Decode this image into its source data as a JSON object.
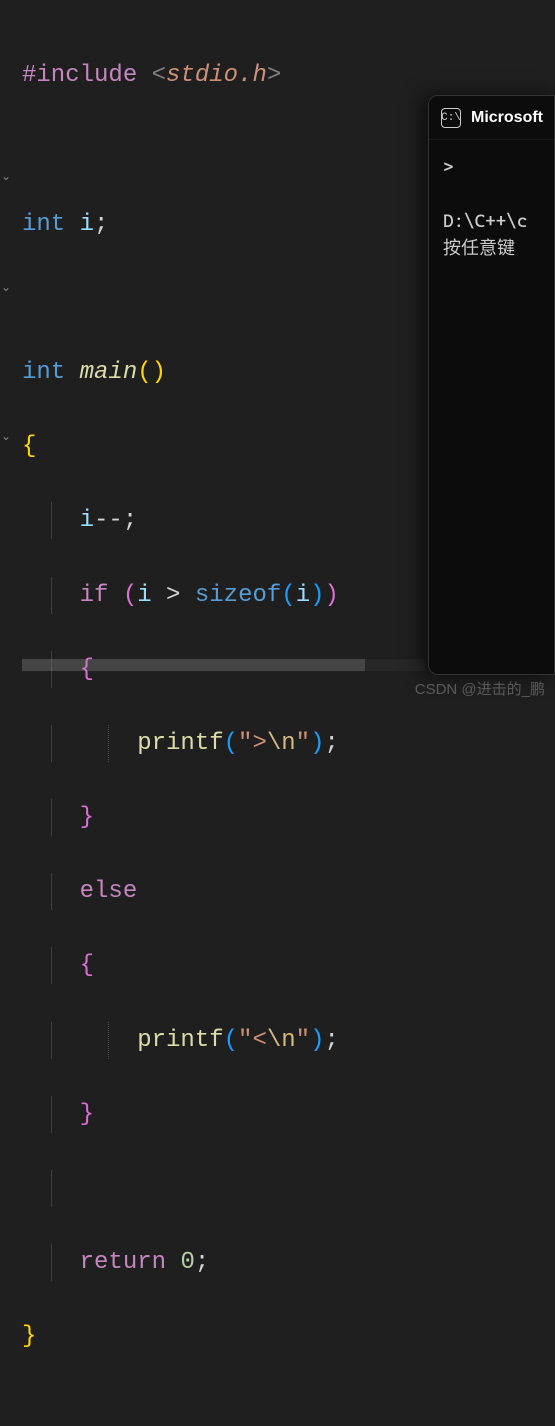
{
  "code": {
    "preproc_directive": "#include",
    "header_open": "<",
    "header_name": "stdio.h",
    "header_close": ">",
    "int_kw": "int",
    "var_i": "i",
    "semicolon": ";",
    "main_name": "main",
    "open_paren": "(",
    "close_paren": ")",
    "open_brace": "{",
    "close_brace": "}",
    "decrement": "--",
    "if_kw": "if",
    "gt_op": ">",
    "sizeof_kw": "sizeof",
    "printf_name": "printf",
    "string_gt_open": "\"",
    "string_gt_body": ">",
    "string_lt_body": "<",
    "escape_n": "\\n",
    "string_close": "\"",
    "else_kw": "else",
    "return_kw": "return",
    "zero": "0"
  },
  "terminal": {
    "title": "Microsoft",
    "icon_glyph": "C:\\",
    "prompt": ">",
    "path_line": "D:\\C++\\c",
    "press_key": "按任意键"
  },
  "watermark": "CSDN @进击的_鹏"
}
